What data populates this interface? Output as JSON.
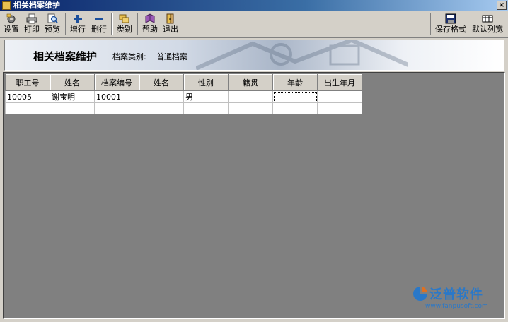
{
  "window": {
    "title": "相关档案维护",
    "close_glyph": "×"
  },
  "toolbar": {
    "left": [
      {
        "label": "设置",
        "icon": "settings-icon"
      },
      {
        "label": "打印",
        "icon": "printer-icon"
      },
      {
        "label": "预览",
        "icon": "preview-icon"
      },
      {
        "label": "增行",
        "icon": "add-row-icon"
      },
      {
        "label": "删行",
        "icon": "delete-row-icon"
      },
      {
        "label": "类别",
        "icon": "category-icon"
      },
      {
        "label": "帮助",
        "icon": "help-book-icon"
      },
      {
        "label": "退出",
        "icon": "exit-door-icon"
      }
    ],
    "right": [
      {
        "label": "保存格式",
        "icon": "save-format-icon"
      },
      {
        "label": "默认列宽",
        "icon": "default-width-icon"
      }
    ]
  },
  "banner": {
    "title": "相关档案维护",
    "category_label": "档案类别:",
    "category_value": "普通档案"
  },
  "grid": {
    "columns": [
      "职工号",
      "姓名",
      "档案编号",
      "姓名",
      "性别",
      "籍贯",
      "年龄",
      "出生年月"
    ],
    "rows": [
      [
        "10005",
        "谢宝明",
        "10001",
        "",
        "男",
        "",
        "",
        ""
      ],
      [
        "",
        "",
        "",
        "",
        "",
        "",
        "",
        ""
      ]
    ]
  },
  "brand": {
    "name": "泛普软件",
    "url": "www.fanpusoft.com"
  },
  "colors": {
    "titlebar": "#0a246a",
    "workspace": "#808080",
    "brand": "#2a78c8"
  }
}
